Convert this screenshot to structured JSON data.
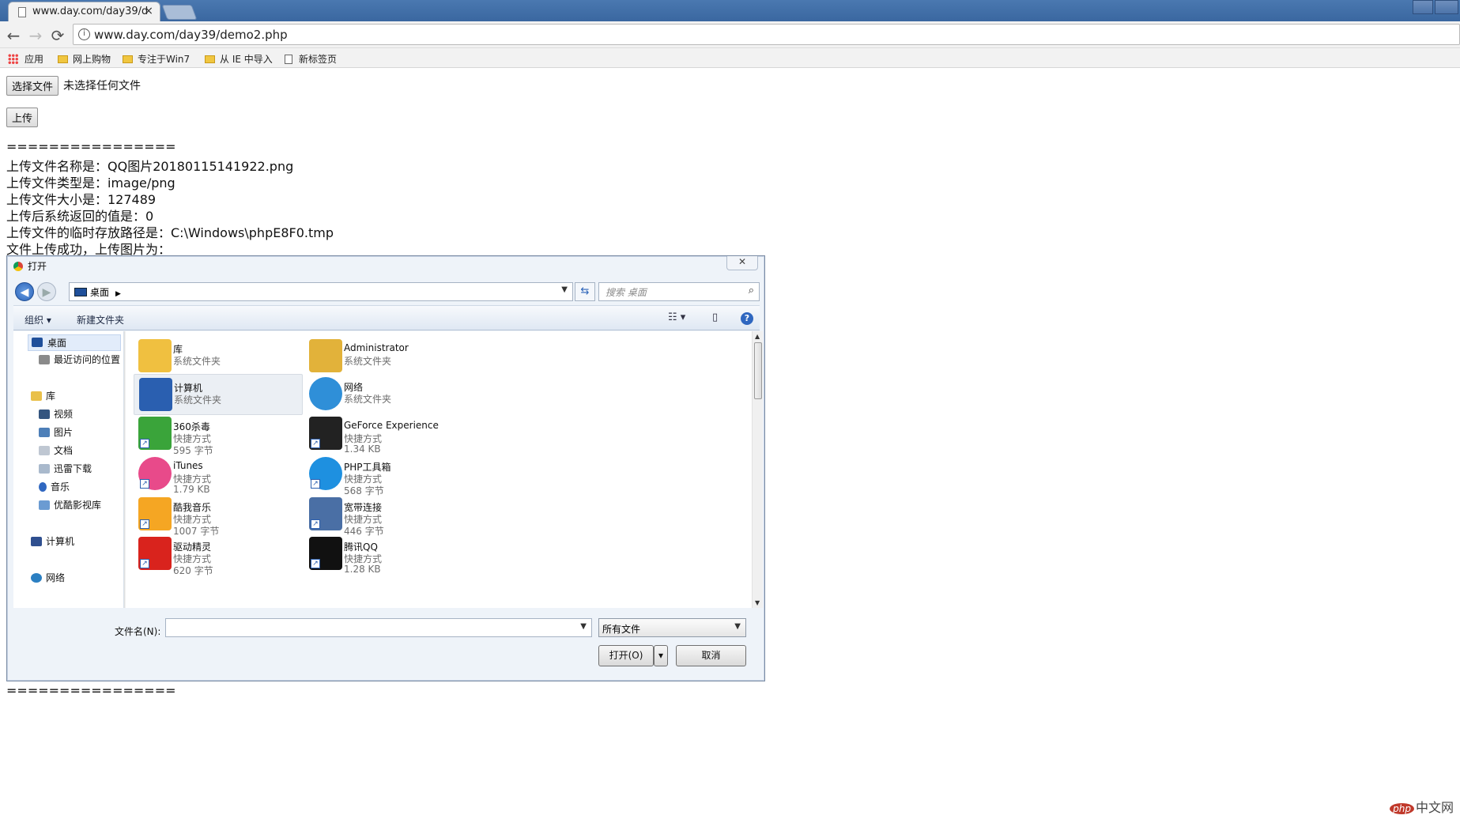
{
  "browser": {
    "tab_title": "www.day.com/day39/d",
    "tab_close": "×",
    "url": "www.day.com/day39/demo2.php",
    "nav": {
      "back": "←",
      "forward": "→",
      "reload": "⟳",
      "info": "i"
    }
  },
  "bookmarks": [
    {
      "label": "应用"
    },
    {
      "label": "网上购物"
    },
    {
      "label": "专注于Win7"
    },
    {
      "label": "从 IE 中导入"
    },
    {
      "label": "新标签页"
    }
  ],
  "page": {
    "choose_file_button": "选择文件",
    "no_file_text": "未选择任何文件",
    "upload_button": "上传",
    "separator": "================",
    "lines": [
      "上传文件名称是：QQ图片20180115141922.png",
      "上传文件类型是：image/png",
      "上传文件大小是：127489",
      "上传后系统返回的值是：0",
      "上传文件的临时存放路径是：C:\\Windows\\phpE8F0.tmp",
      "文件上传成功，上传图片为："
    ],
    "separator_end": "================"
  },
  "dialog": {
    "title": "打开",
    "close": "✕",
    "address": "桌面",
    "search_placeholder": "搜索 桌面",
    "toolbar": {
      "organize": "组织",
      "new_folder": "新建文件夹",
      "help": "?"
    },
    "nav_pane": [
      {
        "label": "桌面",
        "icon": "desktop-icon",
        "color": "#1f4f9a"
      },
      {
        "label": "最近访问的位置",
        "icon": "recent-places-icon",
        "color": "#8a8a8a"
      },
      {
        "label": "库",
        "icon": "library-icon",
        "color": "#e9c04a"
      },
      {
        "label": "视频",
        "icon": "video-icon",
        "color": "#34557f"
      },
      {
        "label": "图片",
        "icon": "pictures-icon",
        "color": "#4d7fb8"
      },
      {
        "label": "文档",
        "icon": "documents-icon",
        "color": "#bfc7d2"
      },
      {
        "label": "迅雷下载",
        "icon": "download-folder-icon",
        "color": "#a9b9cc"
      },
      {
        "label": "音乐",
        "icon": "music-icon",
        "color": "#2f67c0"
      },
      {
        "label": "优酷影视库",
        "icon": "folder-icon",
        "color": "#6b9bd2"
      },
      {
        "label": "计算机",
        "icon": "computer-icon",
        "color": "#2f4f8f"
      },
      {
        "label": "网络",
        "icon": "network-icon",
        "color": "#2b7fc2"
      }
    ],
    "files": [
      {
        "name": "库",
        "line2": "系统文件夹",
        "line3": "",
        "icon": "library-icon",
        "color": "#f0c040",
        "shortcut": false
      },
      {
        "name": "Administrator",
        "line2": "系统文件夹",
        "line3": "",
        "icon": "user-folder-icon",
        "color": "#e2b23a",
        "shortcut": false
      },
      {
        "name": "计算机",
        "line2": "系统文件夹",
        "line3": "",
        "icon": "computer-icon",
        "color": "#2a5fb0",
        "shortcut": false
      },
      {
        "name": "网络",
        "line2": "系统文件夹",
        "line3": "",
        "icon": "network-icon",
        "color": "#2f8fd8",
        "shortcut": false
      },
      {
        "name": "360杀毒",
        "line2": "快捷方式",
        "line3": "595 字节",
        "icon": "360-antivirus-icon",
        "color": "#3aa43a",
        "shortcut": true
      },
      {
        "name": "GeForce Experience",
        "line2": "快捷方式",
        "line3": "1.34 KB",
        "icon": "geforce-icon",
        "color": "#222222",
        "shortcut": true
      },
      {
        "name": "iTunes",
        "line2": "快捷方式",
        "line3": "1.79 KB",
        "icon": "itunes-icon",
        "color": "#e84a8a",
        "shortcut": true
      },
      {
        "name": "PHP工具箱",
        "line2": "快捷方式",
        "line3": "568 字节",
        "icon": "php-toolbox-icon",
        "color": "#1e90e0",
        "shortcut": true
      },
      {
        "name": "酷我音乐",
        "line2": "快捷方式",
        "line3": "1007 字节",
        "icon": "kuwo-music-icon",
        "color": "#f5a623",
        "shortcut": true
      },
      {
        "name": "宽带连接",
        "line2": "快捷方式",
        "line3": "446 字节",
        "icon": "broadband-icon",
        "color": "#4a6fa5",
        "shortcut": true
      },
      {
        "name": "驱动精灵",
        "line2": "快捷方式",
        "line3": "620 字节",
        "icon": "driver-genius-icon",
        "color": "#d9231d",
        "shortcut": true
      },
      {
        "name": "腾讯QQ",
        "line2": "快捷方式",
        "line3": "1.28 KB",
        "icon": "qq-icon",
        "color": "#111111",
        "shortcut": true
      }
    ],
    "filename_label": "文件名(N):",
    "filename_value": "",
    "filetype_value": "所有文件",
    "open_button": "打开(O)",
    "cancel_button": "取消"
  },
  "watermark": {
    "badge": "php",
    "text": "中文网"
  }
}
